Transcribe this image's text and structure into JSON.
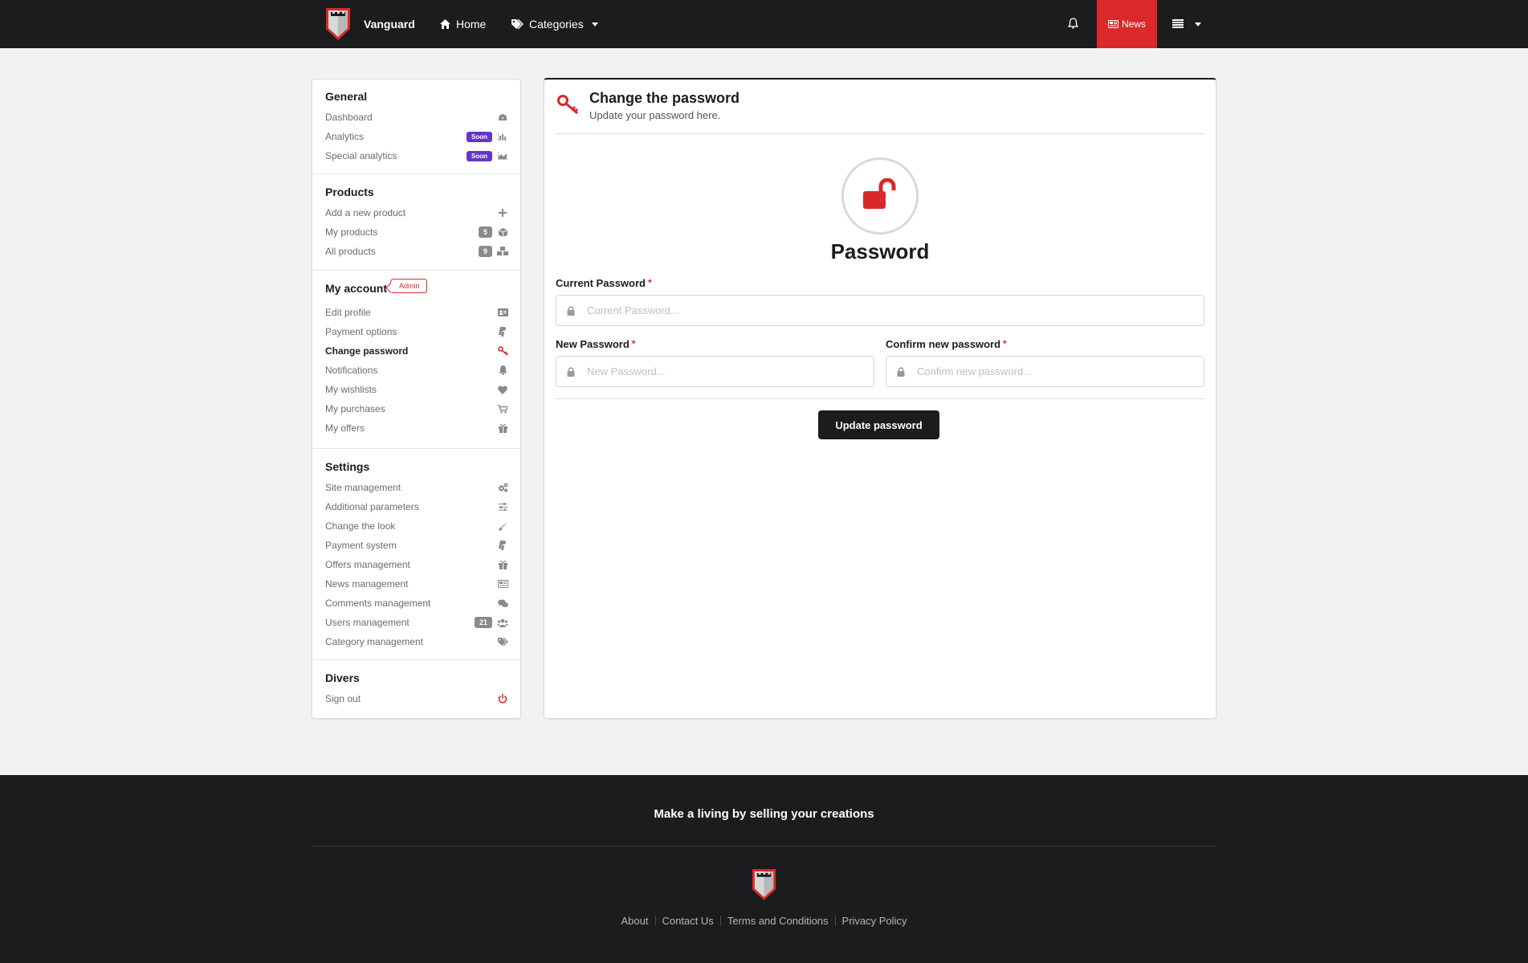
{
  "navbar": {
    "brand": "Vanguard",
    "home": "Home",
    "categories": "Categories",
    "news": "News"
  },
  "sidebar": {
    "general": {
      "title": "General",
      "items": [
        {
          "label": "Dashboard",
          "icon": "dashboard-icon"
        },
        {
          "label": "Analytics",
          "badge": "Soon",
          "icon": "bar-chart-icon"
        },
        {
          "label": "Special analytics",
          "badge": "Soon",
          "icon": "area-chart-icon"
        }
      ]
    },
    "products": {
      "title": "Products",
      "items": [
        {
          "label": "Add a new product",
          "icon": "plus-icon"
        },
        {
          "label": "My products",
          "count": "5",
          "icon": "cube-icon"
        },
        {
          "label": "All products",
          "count": "9",
          "icon": "cubes-icon"
        }
      ]
    },
    "account": {
      "title": "My account",
      "tag": "Admin",
      "items": [
        {
          "label": "Edit profile",
          "icon": "id-card-icon"
        },
        {
          "label": "Payment options",
          "icon": "paypal-icon"
        },
        {
          "label": "Change password",
          "icon": "key-icon",
          "active": true
        },
        {
          "label": "Notifications",
          "icon": "bell-icon"
        },
        {
          "label": "My wishlists",
          "icon": "heart-icon"
        },
        {
          "label": "My purchases",
          "icon": "cart-icon"
        },
        {
          "label": "My offers",
          "icon": "gift-icon"
        }
      ]
    },
    "settings": {
      "title": "Settings",
      "items": [
        {
          "label": "Site management",
          "icon": "cogs-icon"
        },
        {
          "label": "Additional parameters",
          "icon": "sliders-icon"
        },
        {
          "label": "Change the look",
          "icon": "paint-brush-icon"
        },
        {
          "label": "Payment system",
          "icon": "paypal-icon"
        },
        {
          "label": "Offers management",
          "icon": "gift-icon"
        },
        {
          "label": "News management",
          "icon": "newspaper-icon"
        },
        {
          "label": "Comments management",
          "icon": "comments-icon"
        },
        {
          "label": "Users management",
          "count": "21",
          "icon": "users-icon"
        },
        {
          "label": "Category management",
          "icon": "tags-icon"
        }
      ]
    },
    "divers": {
      "title": "Divers",
      "items": [
        {
          "label": "Sign out",
          "icon": "power-icon"
        }
      ]
    }
  },
  "main": {
    "title": "Change the password",
    "subtitle": "Update your password here.",
    "heading": "Password",
    "current": {
      "label": "Current Password",
      "placeholder": "Current Password..."
    },
    "new": {
      "label": "New Password",
      "placeholder": "New Password..."
    },
    "confirm": {
      "label": "Confirm new password",
      "placeholder": "Confirm new password..."
    },
    "required_mark": "*",
    "submit": "Update password"
  },
  "footer": {
    "tagline": "Make a living by selling your creations",
    "links": [
      "About",
      "Contact Us",
      "Terms and Conditions",
      "Privacy Policy"
    ]
  },
  "colors": {
    "accent": "#db2828",
    "dark": "#1b1c1d",
    "soon": "#6435c9",
    "count": "#8a8a8a"
  }
}
